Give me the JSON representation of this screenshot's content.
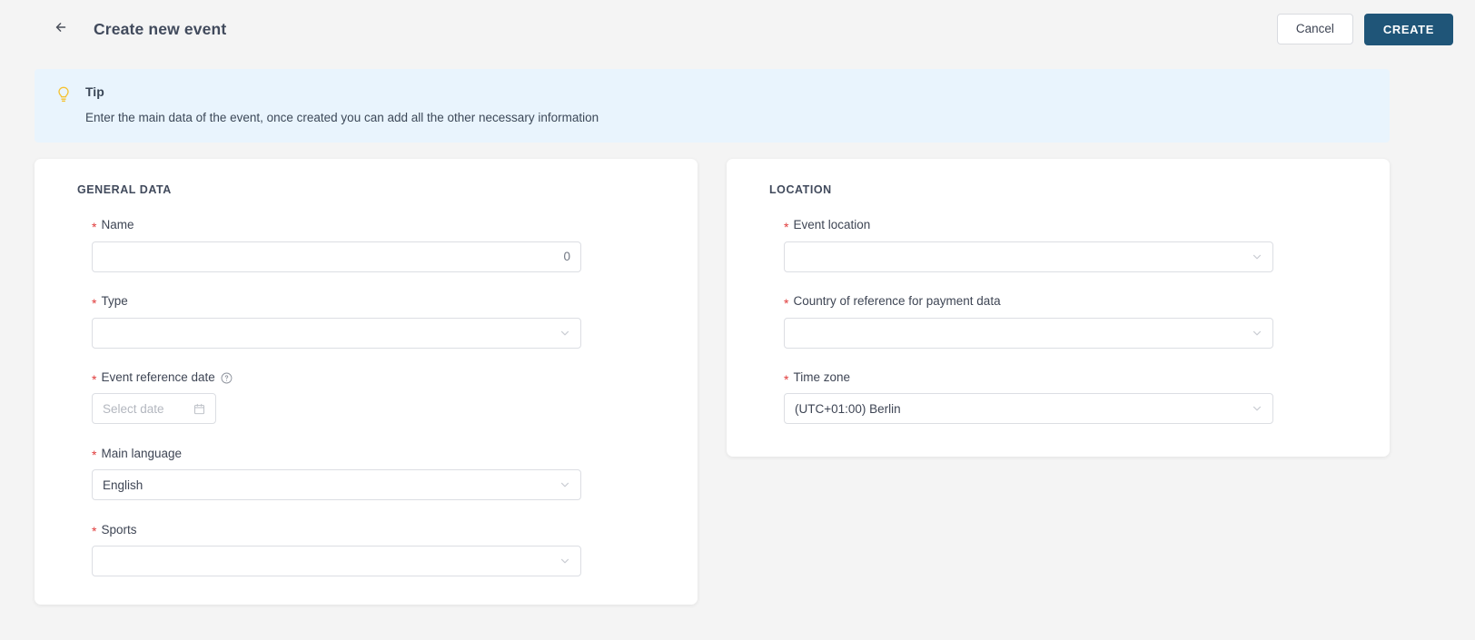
{
  "header": {
    "back_icon": "arrow-left-icon",
    "title": "Create new event",
    "cancel_label": "Cancel",
    "create_label": "CREATE"
  },
  "tip": {
    "icon": "lightbulb-icon",
    "title": "Tip",
    "description": "Enter the main data of the event, once created you can add all the other necessary information"
  },
  "general_data": {
    "heading": "GENERAL DATA",
    "fields": {
      "name": {
        "label": "Name",
        "required_mark": "*",
        "value": "",
        "counter": "0"
      },
      "type": {
        "label": "Type",
        "required_mark": "*",
        "value": "",
        "chevron_icon": "chevron-down-icon"
      },
      "event_reference_date": {
        "label": "Event reference date",
        "required_mark": "*",
        "help_icon": "question-circle-icon",
        "placeholder": "Select date",
        "value": "",
        "calendar_icon": "calendar-icon"
      },
      "main_language": {
        "label": "Main language",
        "required_mark": "*",
        "value": "English",
        "chevron_icon": "chevron-down-icon"
      },
      "sports": {
        "label": "Sports",
        "required_mark": "*",
        "value": "",
        "chevron_icon": "chevron-down-icon"
      }
    }
  },
  "location": {
    "heading": "LOCATION",
    "fields": {
      "event_location": {
        "label": "Event location",
        "required_mark": "*",
        "value": "",
        "chevron_icon": "chevron-down-icon"
      },
      "country_payment": {
        "label": "Country of reference for payment data",
        "required_mark": "*",
        "value": "",
        "chevron_icon": "chevron-down-icon"
      },
      "time_zone": {
        "label": "Time zone",
        "required_mark": "*",
        "value": "(UTC+01:00) Berlin",
        "chevron_icon": "chevron-down-icon"
      }
    }
  },
  "colors": {
    "page_background": "#f4f4f4",
    "primary_button": "#1f5578",
    "tip_background": "#e9f4fd",
    "required_asterisk": "#e03b3b",
    "tip_icon": "#f5c232"
  }
}
